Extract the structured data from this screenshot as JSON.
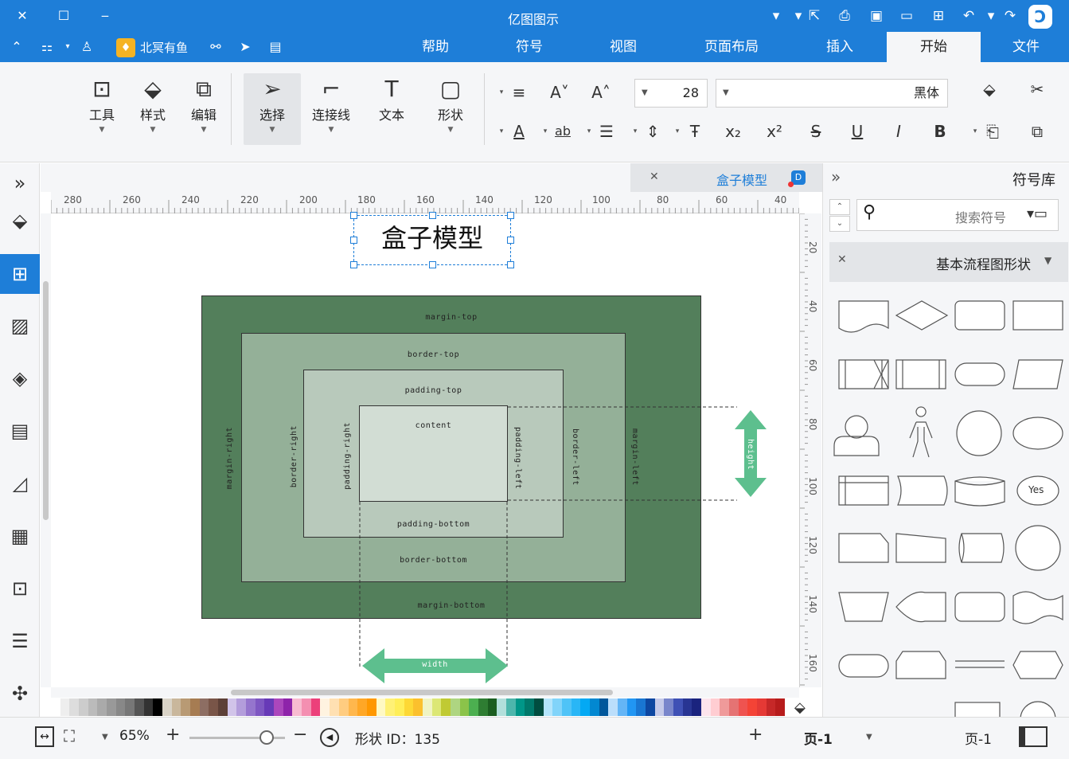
{
  "window": {
    "title": "亿图图示",
    "controls": {
      "close": "✕",
      "maximize": "☐",
      "minimize": "‒"
    }
  },
  "menu": {
    "tabs": [
      "帮助",
      "符号",
      "视图",
      "页面布局",
      "插入",
      "开始",
      "文件"
    ],
    "active_tab": "开始",
    "brand_label": "北冥有鱼"
  },
  "ribbon": {
    "tools": [
      {
        "label": "工具",
        "icon": "tools-icon"
      },
      {
        "label": "样式",
        "icon": "paint-bucket-icon"
      },
      {
        "label": "编辑",
        "icon": "edit-icon"
      },
      {
        "label": "选择",
        "icon": "pointer-icon"
      },
      {
        "label": "连接线",
        "icon": "connector-icon"
      },
      {
        "label": "文本",
        "icon": "text-icon"
      },
      {
        "label": "形状",
        "icon": "shape-icon"
      }
    ],
    "font_size": "28",
    "font_name": "黑体"
  },
  "document": {
    "tab_title": "盒子模型"
  },
  "rulers": {
    "horizontal": [
      "280",
      "260",
      "240",
      "220",
      "200",
      "180",
      "160",
      "140",
      "120",
      "100",
      "80",
      "60",
      "40"
    ],
    "vertical": [
      "20",
      "40",
      "60",
      "80",
      "100",
      "120",
      "140",
      "160"
    ]
  },
  "diagram": {
    "title": "盒子模型",
    "labels": {
      "margin_top": "margin-top",
      "border_top": "border-top",
      "padding_top": "padding-top",
      "content": "content",
      "padding_bottom": "padding-bottom",
      "border_bottom": "border-bottom",
      "margin_bottom": "margin-bottom",
      "margin_right": "margin-right",
      "border_right": "border-right",
      "padding_right": "padding-right",
      "padding_left": "padding-left",
      "border_left": "border-left",
      "margin_left": "margin-left",
      "height": "height",
      "width": "width"
    },
    "colors": {
      "margin": "#537f5b",
      "border": "#94b098",
      "padding": "#b8c9bb",
      "content": "#d2ddd4",
      "arrow": "#5dbf8e"
    }
  },
  "library": {
    "title": "符号库",
    "search_placeholder": "搜索符号",
    "section_title": "基本流程图形状",
    "sample_label": "Yes"
  },
  "status": {
    "page_label": "页-1",
    "page_tab": "页-1",
    "add": "+",
    "shape_id": "形状 ID：135",
    "zoom": "65%"
  }
}
